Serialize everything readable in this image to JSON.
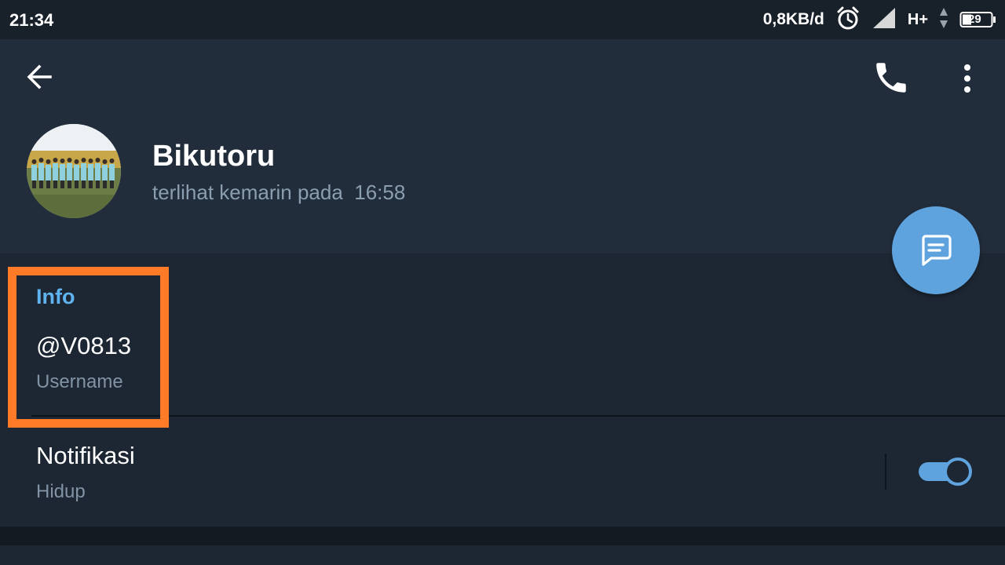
{
  "status_bar": {
    "time": "21:34",
    "speed": "0,8KB/d",
    "network": "H+",
    "battery": "29",
    "icons": [
      "alarm-clock-icon",
      "signal-icon",
      "data-arrows-icon",
      "battery-icon"
    ]
  },
  "toolbar": {
    "back_icon": "arrow-left-icon",
    "call_icon": "phone-icon",
    "menu_icon": "more-vertical-icon"
  },
  "profile": {
    "name": "Bikutoru",
    "last_seen": "terlihat kemarin pada  16:58"
  },
  "fab": {
    "icon": "message-icon"
  },
  "info": {
    "section_title": "Info",
    "username": "@V0813",
    "username_label": "Username"
  },
  "notifications": {
    "title": "Notifikasi",
    "status": "Hidup",
    "enabled": true
  },
  "colors": {
    "header_bg": "#212d3b",
    "section_bg": "#1d2733",
    "accent": "#5fa3de",
    "section_title": "#5fb4f0",
    "highlight": "#ff7b27"
  }
}
